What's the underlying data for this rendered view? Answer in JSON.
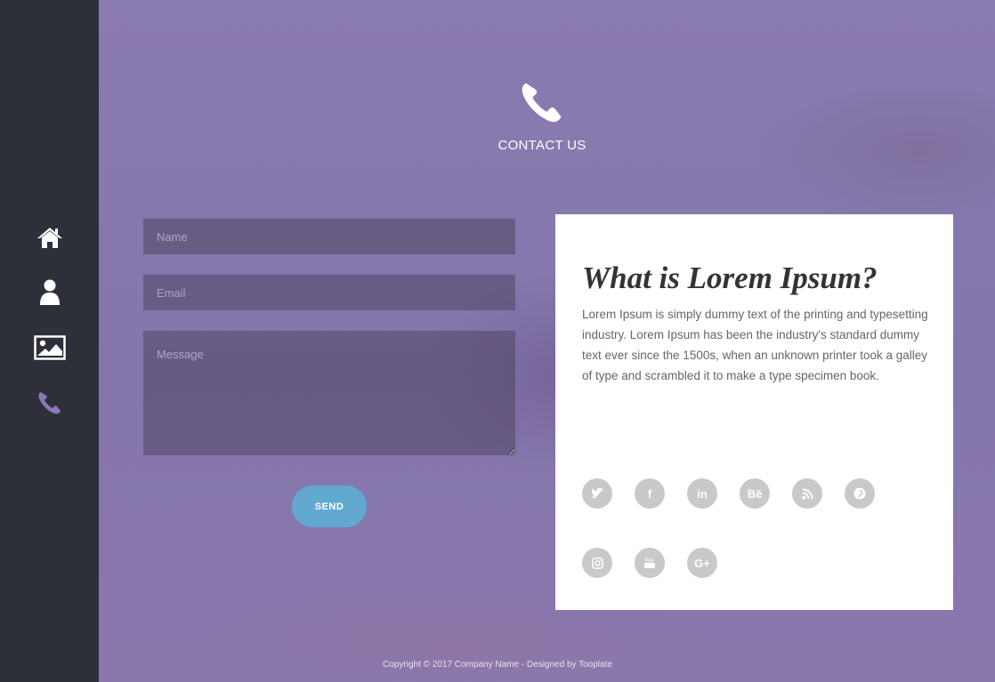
{
  "nav": {
    "items": [
      {
        "name": "home",
        "icon": "home-icon"
      },
      {
        "name": "about",
        "icon": "user-icon"
      },
      {
        "name": "gallery",
        "icon": "image-icon"
      },
      {
        "name": "contact",
        "icon": "phone-icon",
        "active": true
      }
    ],
    "active_color": "#8a78b8"
  },
  "header": {
    "icon": "phone-icon",
    "title": "CONTACT US"
  },
  "form": {
    "name_placeholder": "Name",
    "email_placeholder": "Email",
    "message_placeholder": "Message",
    "send_label": "SEND",
    "send_color": "#62a9cf"
  },
  "card": {
    "title": "What is Lorem Ipsum?",
    "text": "Lorem Ipsum is simply dummy text of the printing and typesetting industry. Lorem Ipsum has been the industry's standard dummy text ever since the 1500s, when an unknown printer took a galley of type and scrambled it to make a type specimen book.",
    "social": [
      {
        "icon": "twitter-icon"
      },
      {
        "icon": "facebook-icon",
        "glyph": "f"
      },
      {
        "icon": "linkedin-icon",
        "glyph": "in"
      },
      {
        "icon": "behance-icon",
        "glyph": "Bē"
      },
      {
        "icon": "rss-icon"
      },
      {
        "icon": "pinterest-icon"
      },
      {
        "icon": "instagram-icon"
      },
      {
        "icon": "youtube-icon"
      },
      {
        "icon": "google-plus-icon",
        "glyph": "G+"
      }
    ]
  },
  "footer": {
    "text": "Copyright © 2017 Company Name - Designed by Tooplate"
  }
}
